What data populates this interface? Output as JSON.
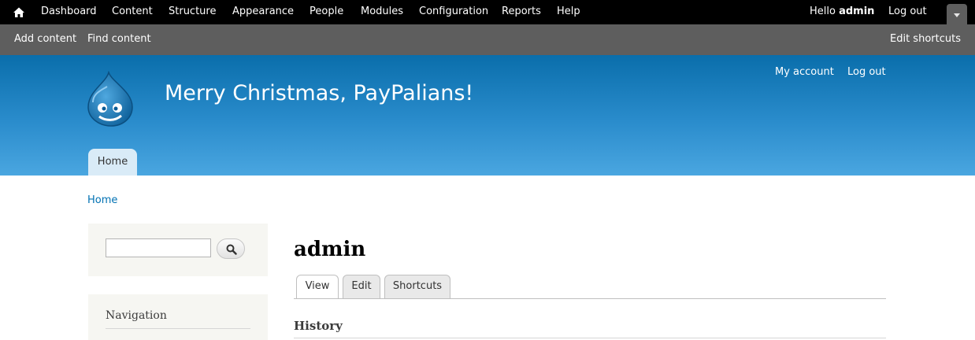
{
  "toolbar": {
    "home_icon": "home-icon",
    "menu": [
      {
        "label": "Dashboard"
      },
      {
        "label": "Content"
      },
      {
        "label": "Structure"
      },
      {
        "label": "Appearance"
      },
      {
        "label": "People"
      },
      {
        "label": "Modules"
      },
      {
        "label": "Configuration"
      },
      {
        "label": "Reports"
      },
      {
        "label": "Help"
      }
    ],
    "hello": "Hello",
    "username": "admin",
    "logout": "Log out",
    "drawer_icon": "chevron-down-icon"
  },
  "shortcuts": {
    "items": [
      {
        "label": "Add content"
      },
      {
        "label": "Find content"
      }
    ],
    "edit": "Edit shortcuts"
  },
  "header": {
    "site_name": "Merry Christmas, PayPalians!",
    "logo_icon": "drupal-drop-logo",
    "secondary_menu": [
      {
        "label": "My account"
      },
      {
        "label": "Log out"
      }
    ],
    "main_menu": [
      {
        "label": "Home"
      }
    ]
  },
  "breadcrumb": [
    "Home"
  ],
  "sidebar": {
    "search": {
      "value": "",
      "button_icon": "search-icon"
    },
    "navigation_title": "Navigation"
  },
  "main": {
    "title": "admin",
    "tabs": [
      {
        "label": "View",
        "active": true
      },
      {
        "label": "Edit",
        "active": false
      },
      {
        "label": "Shortcuts",
        "active": false
      }
    ],
    "section_heading": "History"
  },
  "colors": {
    "toolbar": "#000000",
    "shortcut_bar": "#5e5e5e",
    "header_top": "#0a6eab",
    "header_bottom": "#4aa6e0",
    "link": "#0071b3",
    "sidebar_bg": "#f6f6f2"
  }
}
